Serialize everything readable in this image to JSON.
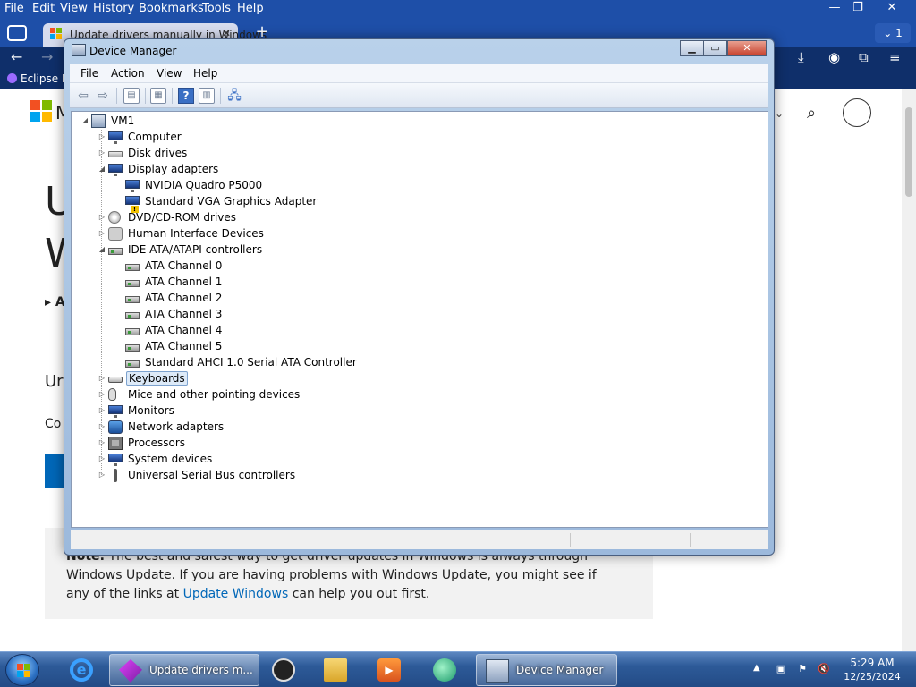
{
  "browser": {
    "menu": [
      "File",
      "Edit",
      "View",
      "History",
      "Bookmarks",
      "Tools",
      "Help"
    ],
    "tab": {
      "title": "Update drivers manually in Windows",
      "close": "✕"
    },
    "new_tab": "+",
    "tab_count": "1",
    "bookmark": "Eclipse M",
    "page": {
      "peeks": [
        "U",
        "W",
        "▸ A",
        "Ur",
        "Co"
      ],
      "note": {
        "label": "Note:",
        "text": " The best and safest way to get driver updates in Windows is always through Windows Update. If you are having problems with Windows Update, you might see if any of the links at ",
        "link": "Update Windows",
        "tail": " can help you out first."
      }
    }
  },
  "device_manager": {
    "title": "Device Manager",
    "menu": [
      "File",
      "Action",
      "View",
      "Help"
    ],
    "tree": [
      {
        "label": "VM1",
        "level": 0,
        "expanded": true,
        "icon": "computer-icon"
      },
      {
        "label": "Computer",
        "level": 1,
        "icon": "monitor-icon"
      },
      {
        "label": "Disk drives",
        "level": 1,
        "icon": "drive-icon"
      },
      {
        "label": "Display adapters",
        "level": 1,
        "expanded": true,
        "icon": "monitor-icon"
      },
      {
        "label": "NVIDIA Quadro P5000",
        "level": 2,
        "icon": "monitor-icon"
      },
      {
        "label": "Standard VGA Graphics Adapter",
        "level": 2,
        "icon": "monitor-warning-icon"
      },
      {
        "label": "DVD/CD-ROM drives",
        "level": 1,
        "icon": "disc-icon"
      },
      {
        "label": "Human Interface Devices",
        "level": 1,
        "icon": "hid-icon"
      },
      {
        "label": "IDE ATA/ATAPI controllers",
        "level": 1,
        "expanded": true,
        "icon": "port-icon"
      },
      {
        "label": "ATA Channel 0",
        "level": 2,
        "icon": "port-icon"
      },
      {
        "label": "ATA Channel 1",
        "level": 2,
        "icon": "port-icon"
      },
      {
        "label": "ATA Channel 2",
        "level": 2,
        "icon": "port-icon"
      },
      {
        "label": "ATA Channel 3",
        "level": 2,
        "icon": "port-icon"
      },
      {
        "label": "ATA Channel 4",
        "level": 2,
        "icon": "port-icon"
      },
      {
        "label": "ATA Channel 5",
        "level": 2,
        "icon": "port-icon"
      },
      {
        "label": "Standard AHCI 1.0 Serial ATA Controller",
        "level": 2,
        "icon": "port-icon"
      },
      {
        "label": "Keyboards",
        "level": 1,
        "selected": true,
        "icon": "keyboard-icon"
      },
      {
        "label": "Mice and other pointing devices",
        "level": 1,
        "icon": "mouse-icon"
      },
      {
        "label": "Monitors",
        "level": 1,
        "icon": "monitor-icon"
      },
      {
        "label": "Network adapters",
        "level": 1,
        "icon": "network-icon"
      },
      {
        "label": "Processors",
        "level": 1,
        "icon": "cpu-icon"
      },
      {
        "label": "System devices",
        "level": 1,
        "icon": "monitor-icon"
      },
      {
        "label": "Universal Serial Bus controllers",
        "level": 1,
        "icon": "usb-icon"
      }
    ]
  },
  "taskbar": {
    "apps": [
      {
        "label": "Update drivers m...",
        "icon": "browser-icon"
      },
      {
        "label": "Device Manager",
        "icon": "device-manager-icon"
      }
    ],
    "clock": {
      "time": "5:29 AM",
      "date": "12/25/2024"
    }
  }
}
